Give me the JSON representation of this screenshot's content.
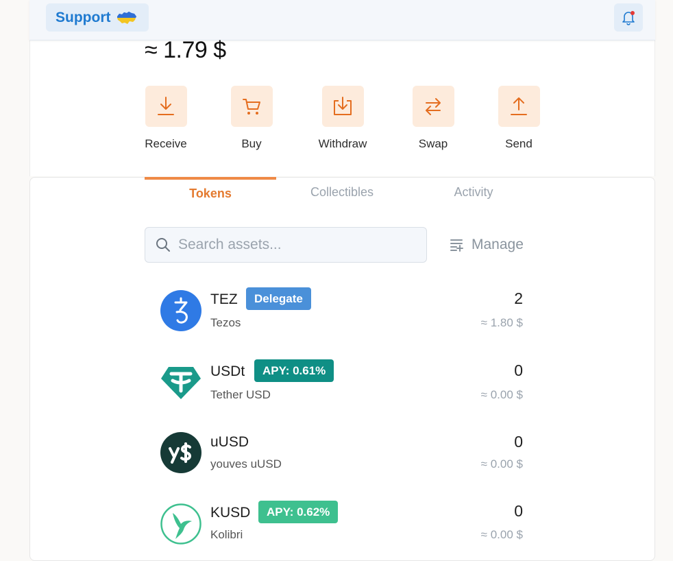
{
  "header": {
    "support_label": "Support",
    "support_flag": "ukraine-flag-icon",
    "notification_icon": "bell-icon",
    "notification_dot_color": "#e53935"
  },
  "balance": {
    "text": "≈ 1.79 $"
  },
  "actions": [
    {
      "label": "Receive",
      "icon": "download-icon"
    },
    {
      "label": "Buy",
      "icon": "cart-icon"
    },
    {
      "label": "Withdraw",
      "icon": "withdraw-icon"
    },
    {
      "label": "Swap",
      "icon": "swap-arrows-icon"
    },
    {
      "label": "Send",
      "icon": "upload-icon"
    }
  ],
  "tabs": [
    {
      "label": "Tokens",
      "active": true
    },
    {
      "label": "Collectibles",
      "active": false
    },
    {
      "label": "Activity",
      "active": false
    }
  ],
  "search": {
    "placeholder": "Search assets..."
  },
  "manage_label": "Manage",
  "tokens": [
    {
      "symbol": "TEZ",
      "name": "Tezos",
      "badge": "Delegate",
      "badge_color": "#4a90d9",
      "amount": "2",
      "fiat": "≈ 1.80 $",
      "logo_color": "#2f7ae5"
    },
    {
      "symbol": "USDt",
      "name": "Tether USD",
      "badge": "APY: 0.61%",
      "badge_color": "#0f8f85",
      "amount": "0",
      "fiat": "≈ 0.00 $",
      "logo_color": "#1a9a8a"
    },
    {
      "symbol": "uUSD",
      "name": "youves uUSD",
      "badge": "",
      "badge_color": "",
      "amount": "0",
      "fiat": "≈ 0.00 $",
      "logo_color": "#163a36"
    },
    {
      "symbol": "KUSD",
      "name": "Kolibri",
      "badge": "APY: 0.62%",
      "badge_color": "#3ec08f",
      "amount": "0",
      "fiat": "≈ 0.00 $",
      "logo_color": "#3ec08f"
    }
  ],
  "colors": {
    "accent": "#ef8a46",
    "action_bg": "#fdebdc",
    "link_blue": "#1f7ad0"
  }
}
